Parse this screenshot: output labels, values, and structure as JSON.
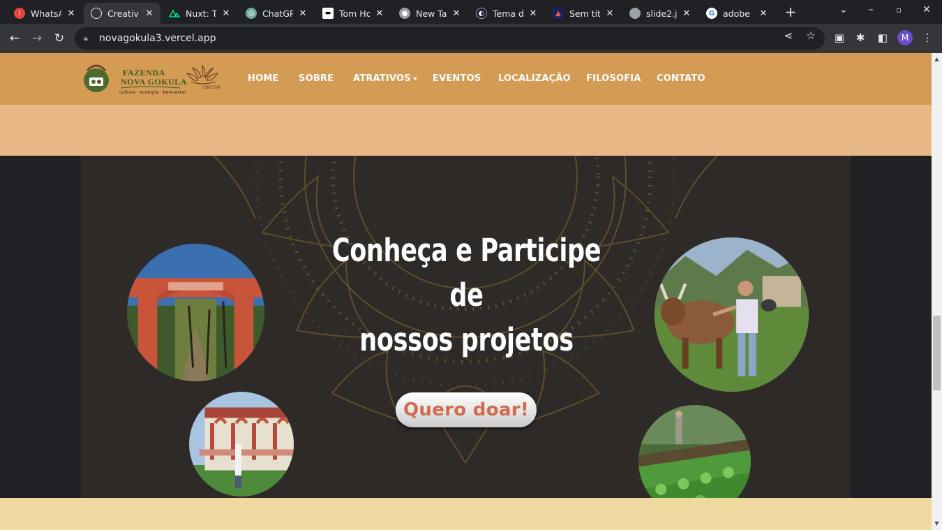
{
  "browser": {
    "tabs": [
      {
        "title": "WhatsA",
        "icon": "whatsapp-icon",
        "color": "#e8453c"
      },
      {
        "title": "Creativ",
        "icon": "globe-icon",
        "color": "#3c4043",
        "active": true
      },
      {
        "title": "Nuxt: Tl",
        "icon": "nuxt-icon",
        "color": "#00dc82"
      },
      {
        "title": "ChatGP",
        "icon": "chatgpt-icon",
        "color": "#74aa9c"
      },
      {
        "title": "Tom Ho",
        "icon": "site-icon",
        "color": "#ffffff"
      },
      {
        "title": "New Ta",
        "icon": "chrome-icon",
        "color": "#9aa0a6"
      },
      {
        "title": "Tema d",
        "icon": "site-icon",
        "color": "#1a1a2e"
      },
      {
        "title": "Sem tít",
        "icon": "app-icon",
        "color": "#1f1f5c"
      },
      {
        "title": "slide2.j",
        "icon": "globe-icon",
        "color": "#9aa0a6"
      },
      {
        "title": "adobe",
        "icon": "google-icon",
        "color": "#ffffff"
      }
    ],
    "url": "novagokula3.vercel.app",
    "profile_initial": "M"
  },
  "site": {
    "logo": {
      "line1": "FAZENDA",
      "line2": "NOVA GOKULA",
      "tagline": "cultura · ecologia · bem-estar",
      "iskcon": "ISKCON"
    },
    "nav": [
      "HOME",
      "SOBRE",
      "ATRATIVOS",
      "EVENTOS",
      "LOCALIZAÇÃO",
      "FILOSOFIA",
      "CONTATO"
    ],
    "colors": {
      "header": "#d49b55",
      "band_top": "#e8b886",
      "hero_bg": "#2d2a28",
      "band_bottom": "#eed9a0",
      "button_text": "#d26a4e"
    }
  },
  "hero": {
    "title_line1": "Conheça e Participe de",
    "title_line2": "nossos projetos",
    "cta": "Quero doar!",
    "photos": [
      "entrance-gate-photo",
      "man-with-cow-photo",
      "temple-porch-photo",
      "vegetable-garden-photo"
    ]
  }
}
